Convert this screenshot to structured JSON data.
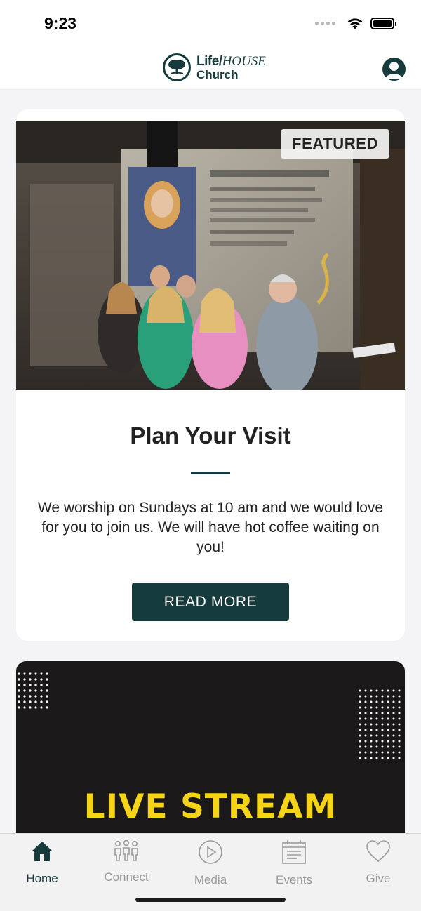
{
  "status_bar": {
    "time": "9:23"
  },
  "header": {
    "logo_life": "Life",
    "logo_house": "HOUSE",
    "logo_church": "Church"
  },
  "featured": {
    "badge": "FEATURED",
    "title": "Plan Your Visit",
    "body": "We worship on Sundays at 10 am and we would love for you to join us. We will have hot coffee waiting on you!",
    "button_label": "READ MORE"
  },
  "live_stream": {
    "title": "LIVE STREAM"
  },
  "tab_bar": {
    "items": [
      {
        "label": "Home",
        "icon": "home-icon",
        "active": true
      },
      {
        "label": "Connect",
        "icon": "people-icon",
        "active": false
      },
      {
        "label": "Media",
        "icon": "play-icon",
        "active": false
      },
      {
        "label": "Events",
        "icon": "calendar-icon",
        "active": false
      },
      {
        "label": "Give",
        "icon": "heart-icon",
        "active": false
      }
    ]
  },
  "colors": {
    "brand": "#163b3c",
    "live_accent": "#f5d417",
    "tab_inactive": "#9a9a9a"
  }
}
